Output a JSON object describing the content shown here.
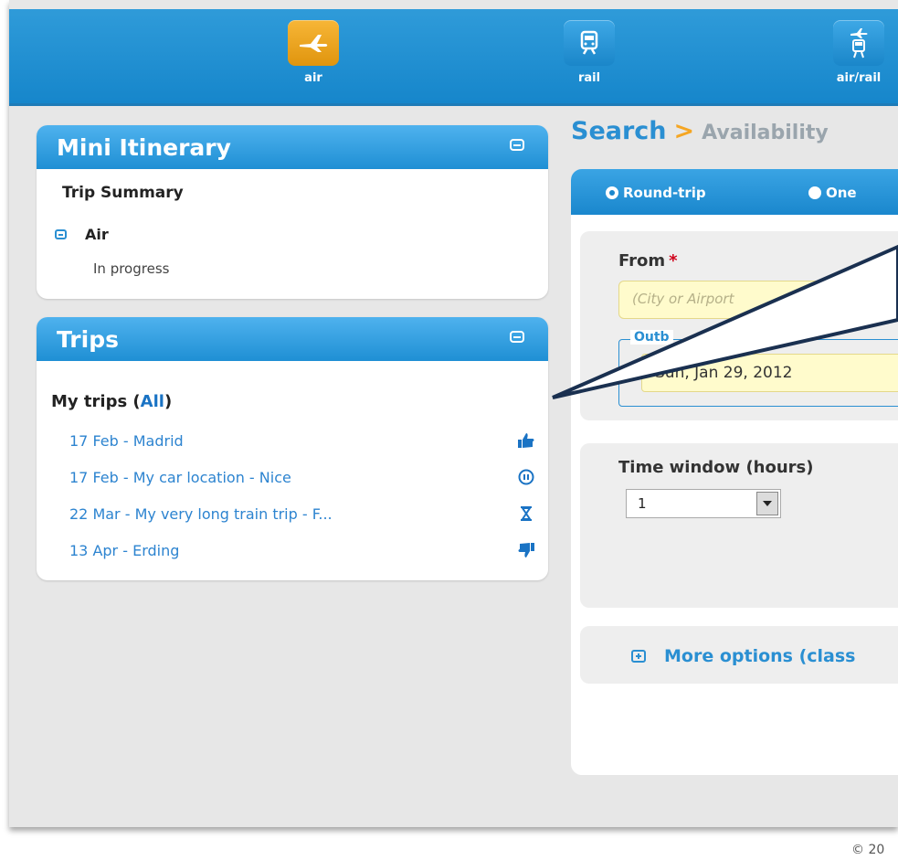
{
  "nav": {
    "modes": [
      {
        "label": "air",
        "icon": "plane-icon",
        "active": true
      },
      {
        "label": "rail",
        "icon": "train-icon",
        "active": false
      },
      {
        "label": "air/rail",
        "icon": "plane-train-icon",
        "active": false
      }
    ]
  },
  "mini_itinerary": {
    "title": "Mini Itinerary",
    "trip_summary": "Trip Summary",
    "air_label": "Air",
    "status": "In progress"
  },
  "trips": {
    "title": "Trips",
    "my_trips_prefix": "My trips (",
    "all_link": "All",
    "my_trips_suffix": ")",
    "items": [
      {
        "date": "17 Feb - ",
        "name": "Madrid",
        "status_icon": "thumbs-up-icon"
      },
      {
        "date": "17 Feb - ",
        "name": "My car location - Nice",
        "status_icon": "pause-icon"
      },
      {
        "date": "22 Mar - ",
        "name": "My very long train trip - F...",
        "status_icon": "hourglass-icon"
      },
      {
        "date": "13 Apr - ",
        "name": "Erding",
        "status_icon": "thumbs-down-icon"
      }
    ]
  },
  "breadcrumb": {
    "current": "Search",
    "separator": ">",
    "next": "Availability"
  },
  "search": {
    "trip_types": [
      {
        "label": "Round-trip",
        "checked": true
      },
      {
        "label": "One",
        "checked": false
      }
    ],
    "from_label": "From",
    "required_mark": "*",
    "from_placeholder": "(City or Airport",
    "outbound_legend": "Outb",
    "outbound_date": "Sun, Jan 29, 2012",
    "time_window_label": "Time window (hours)",
    "time_window_value": "1",
    "more_options": "More options (class"
  },
  "footer": {
    "copyright": "© 20"
  },
  "colors": {
    "brand_blue": "#1f8fd4",
    "active_orange": "#f0a625",
    "link_blue": "#2d84d0",
    "input_yellow": "#fffbcc"
  }
}
